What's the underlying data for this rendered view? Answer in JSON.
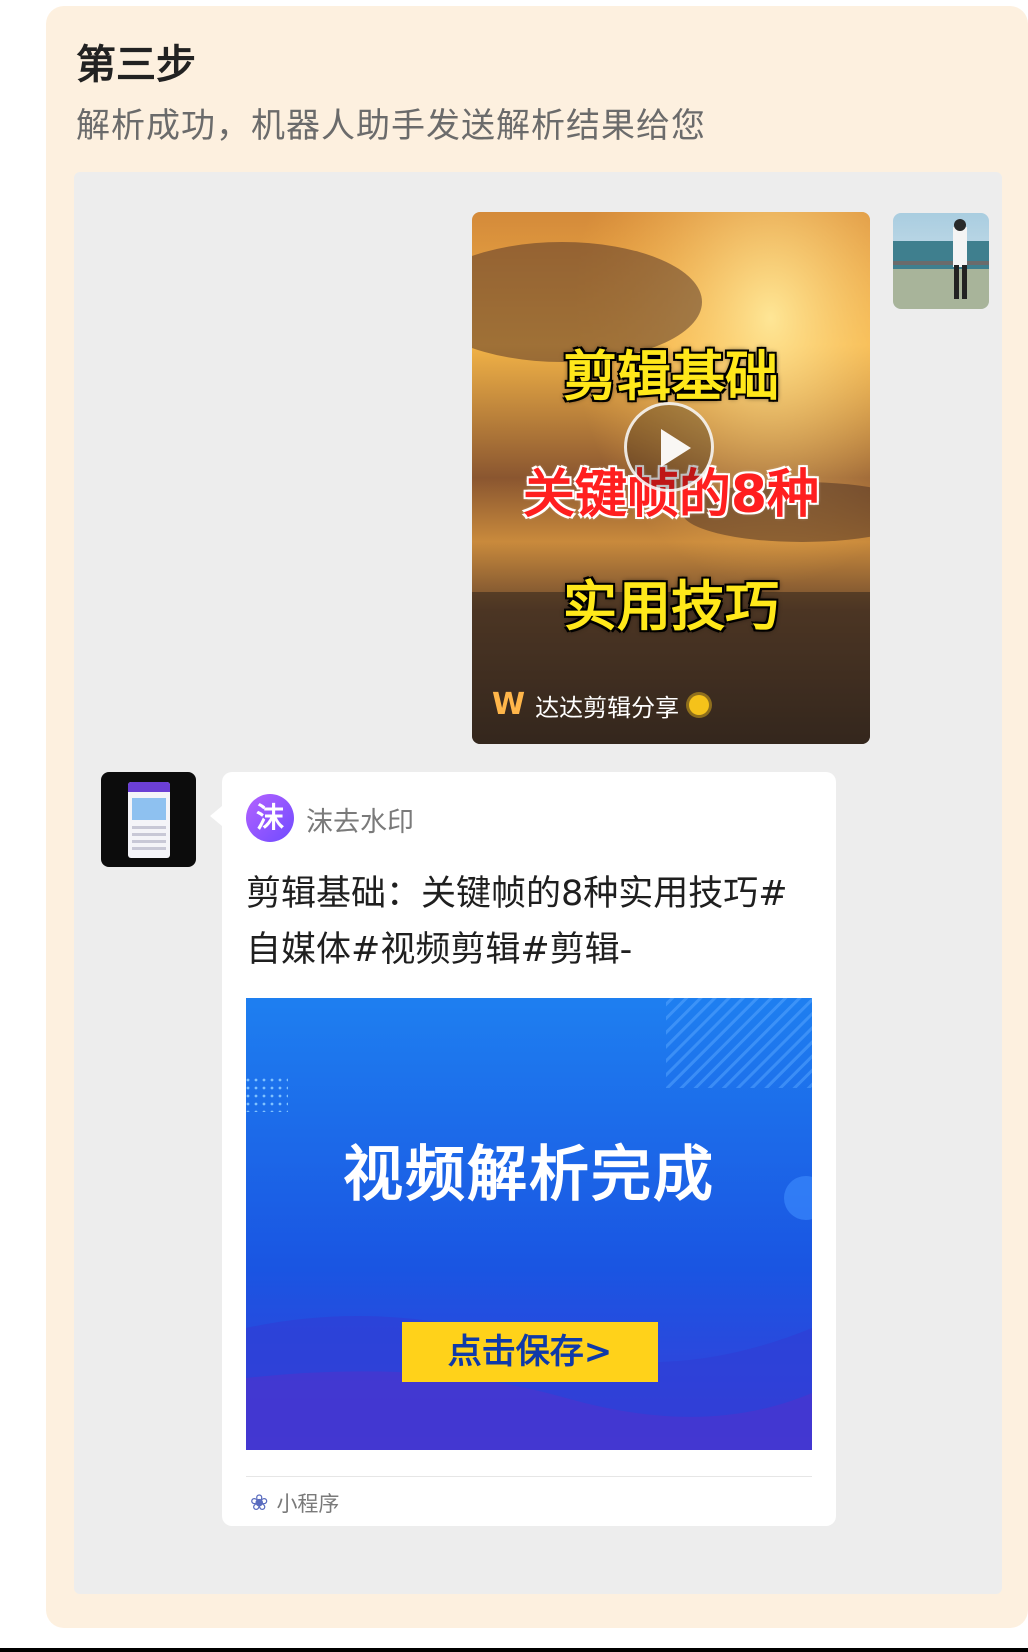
{
  "step": {
    "title": "第三步",
    "description": "解析成功，机器人助手发送解析结果给您"
  },
  "video_message": {
    "line1": "剪辑基础",
    "line2": "关键帧的8种",
    "line3": "实用技巧",
    "author": "达达剪辑分享",
    "author_logo": "W",
    "icons": [
      "play-icon",
      "verified-badge-icon"
    ]
  },
  "mini_program": {
    "logo_char": "沫",
    "name": "沫去水印",
    "title": "剪辑基础：关键帧的8种实用技巧#自媒体#视频剪辑#剪辑-",
    "headline": "视频解析完成",
    "save_button": "点击保存>",
    "footer_label": "小程序",
    "footer_icon": "link-icon"
  },
  "colors": {
    "card_bg": "#fdf0df",
    "chat_bg": "#ededed",
    "banner_blue": "#1f63e8",
    "save_yellow": "#ffd21a"
  }
}
